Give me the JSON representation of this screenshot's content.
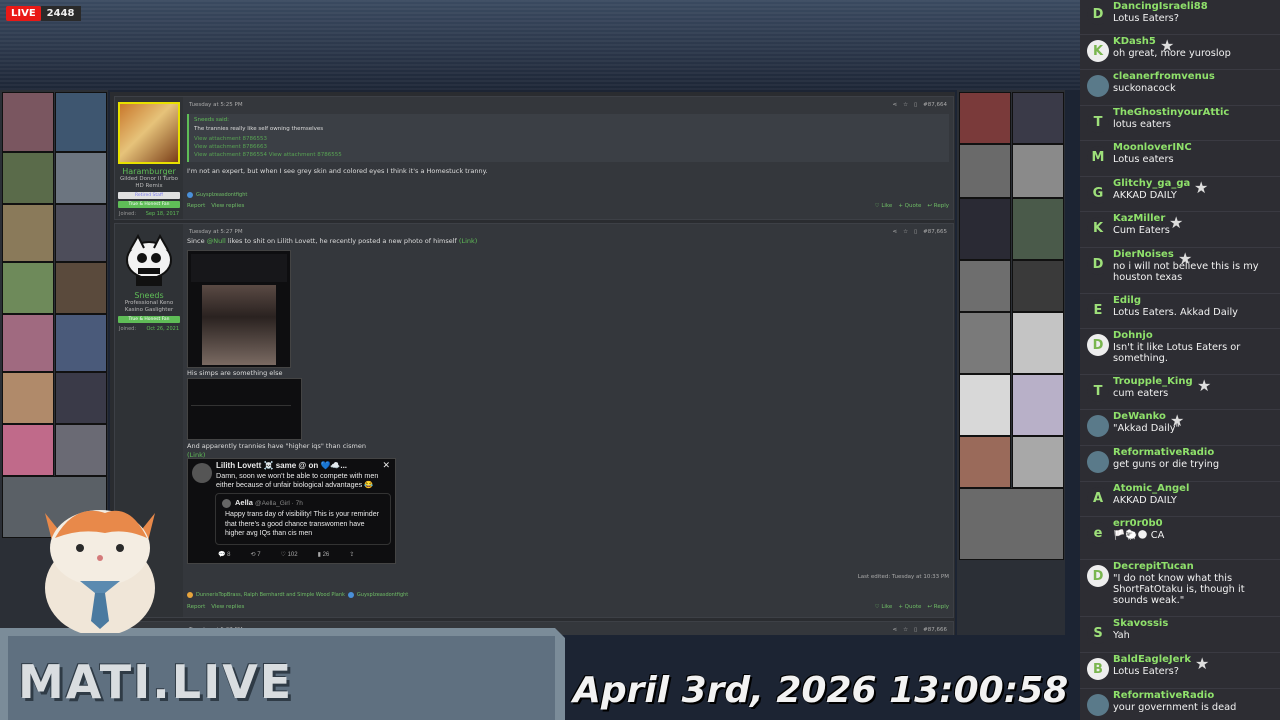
{
  "stream": {
    "live_label": "LIVE",
    "viewer_count": "2448"
  },
  "overlay": {
    "brand": "MATI.LIVE",
    "datetime": "April 3rd, 2026 13:00:58"
  },
  "post1": {
    "author": "Haramburger",
    "user_title": "Gilded Donor II Turbo HD Remix",
    "banner1": "Retired Staff",
    "banner2": "True & Honest Fan",
    "joined_label": "Joined:",
    "joined_date": "Sep 18, 2017",
    "timestamp": "Tuesday at 5:25 PM",
    "post_number": "#87,664",
    "quote_author": "Sneeds said:",
    "quote_text": "The trannies really like self owning themselves",
    "quote_attachments": [
      "View attachment 8786553",
      "View attachment 8786663",
      "View attachment 8786554 View attachment 8786555"
    ],
    "body": "I'm not an expert, but when I see grey skin and colored eyes I think it's a Homestuck tranny.",
    "reactor": "Guysplzeasdontfight",
    "report": "Report",
    "view_replies": "View replies",
    "like": "Like",
    "quote": "Quote",
    "reply": "Reply"
  },
  "post2": {
    "author": "Sneeds",
    "user_title_1": "Professional Keno",
    "user_title_2": "Kasino Gaslighter",
    "banner": "True & Honest Fan",
    "joined_label": "Joined:",
    "joined_date": "Oct 26, 2021",
    "timestamp": "Tuesday at 5:27 PM",
    "post_number": "#87,665",
    "line1_pre": "Since",
    "line1_mention": "@Null",
    "line1_post": "likes to shit on Lilith Lovett, he recently posted a new photo of himself",
    "link_label": "(Link)",
    "line2": "His simps are something else",
    "line3": "And apparently trannies have \"higher iqs\" than cismen",
    "tweet_author": "Lilith Lovett ☠️ same @ on 💙☁️...",
    "tweet_text": "Damn, soon we won't be able to compete with men either because of unfair biological advantages 😂",
    "tweet_quoted_author": "Aella",
    "tweet_quoted_handle": "@Aella_Girl · 7h",
    "tweet_quoted_text": "Happy trans day of visibility! This is your reminder that there's a good chance transwomen have higher avg IQs than cis men",
    "tweet_stats": [
      "8",
      "7",
      "102",
      "26"
    ],
    "edited": "Last edited: Tuesday at 10:33 PM",
    "reactors": "DunnerisTopBrass, Ralph Bernhardt and Simple Wood Plank",
    "reactor2": "Guysplzeasdontfight",
    "report": "Report",
    "view_replies": "View replies",
    "like": "Like",
    "quote": "Quote",
    "reply": "Reply"
  },
  "post3": {
    "timestamp": "Tuesday at 5:27 PM",
    "post_number": "#87,666"
  },
  "chat": [
    {
      "name": "DancingIsraeli88",
      "text": "Lotus Eaters?",
      "avatar": "D",
      "star": false
    },
    {
      "name": "KDash5",
      "text": "oh great, more yuroslop",
      "avatar": "K",
      "star": true
    },
    {
      "name": "cleanerfromvenus",
      "text": "suckonacock",
      "avatar": "",
      "star": false
    },
    {
      "name": "TheGhostinyourAttic",
      "text": "lotus eaters",
      "avatar": "T",
      "star": false
    },
    {
      "name": "MoonloverINC",
      "text": "Lotus eaters",
      "avatar": "M",
      "star": false
    },
    {
      "name": "Glitchy_ga_ga",
      "text": "AKKAD DAILY",
      "avatar": "G",
      "star": true
    },
    {
      "name": "KazMiller",
      "text": "Cum Eaters",
      "avatar": "K",
      "star": true
    },
    {
      "name": "DierNoises",
      "text": "no i will not believe this is my houston texas",
      "avatar": "D",
      "star": true
    },
    {
      "name": "Edilg",
      "text": "Lotus Eaters. Akkad Daily",
      "avatar": "E",
      "star": false
    },
    {
      "name": "Dohnjo",
      "text": "Isn't it like Lotus Eaters or something.",
      "avatar": "D",
      "star": false
    },
    {
      "name": "Troupple_King",
      "text": "cum eaters",
      "avatar": "T",
      "star": true
    },
    {
      "name": "DeWanko",
      "text": "\"Akkad Daily\"",
      "avatar": "",
      "star": true
    },
    {
      "name": "ReformativeRadio",
      "text": "get guns or die trying",
      "avatar": "",
      "star": false
    },
    {
      "name": "Atomic_Angel",
      "text": "AKKAD DAILY",
      "avatar": "A",
      "star": false
    },
    {
      "name": "err0r0b0",
      "text": "🏳️🐑🌑 CA",
      "avatar": "e",
      "star": false
    },
    {
      "name": "DecrepitTucan",
      "text": "\"I do not know what this ShortFatOtaku is, though it sounds weak.\"",
      "avatar": "D",
      "star": false
    },
    {
      "name": "Skavossis",
      "text": "Yah",
      "avatar": "S",
      "star": false
    },
    {
      "name": "BaldEagleJerk",
      "text": "Lotus Eaters?",
      "avatar": "B",
      "star": true
    },
    {
      "name": "ReformativeRadio",
      "text": "your government is dead",
      "avatar": "",
      "star": false
    }
  ]
}
